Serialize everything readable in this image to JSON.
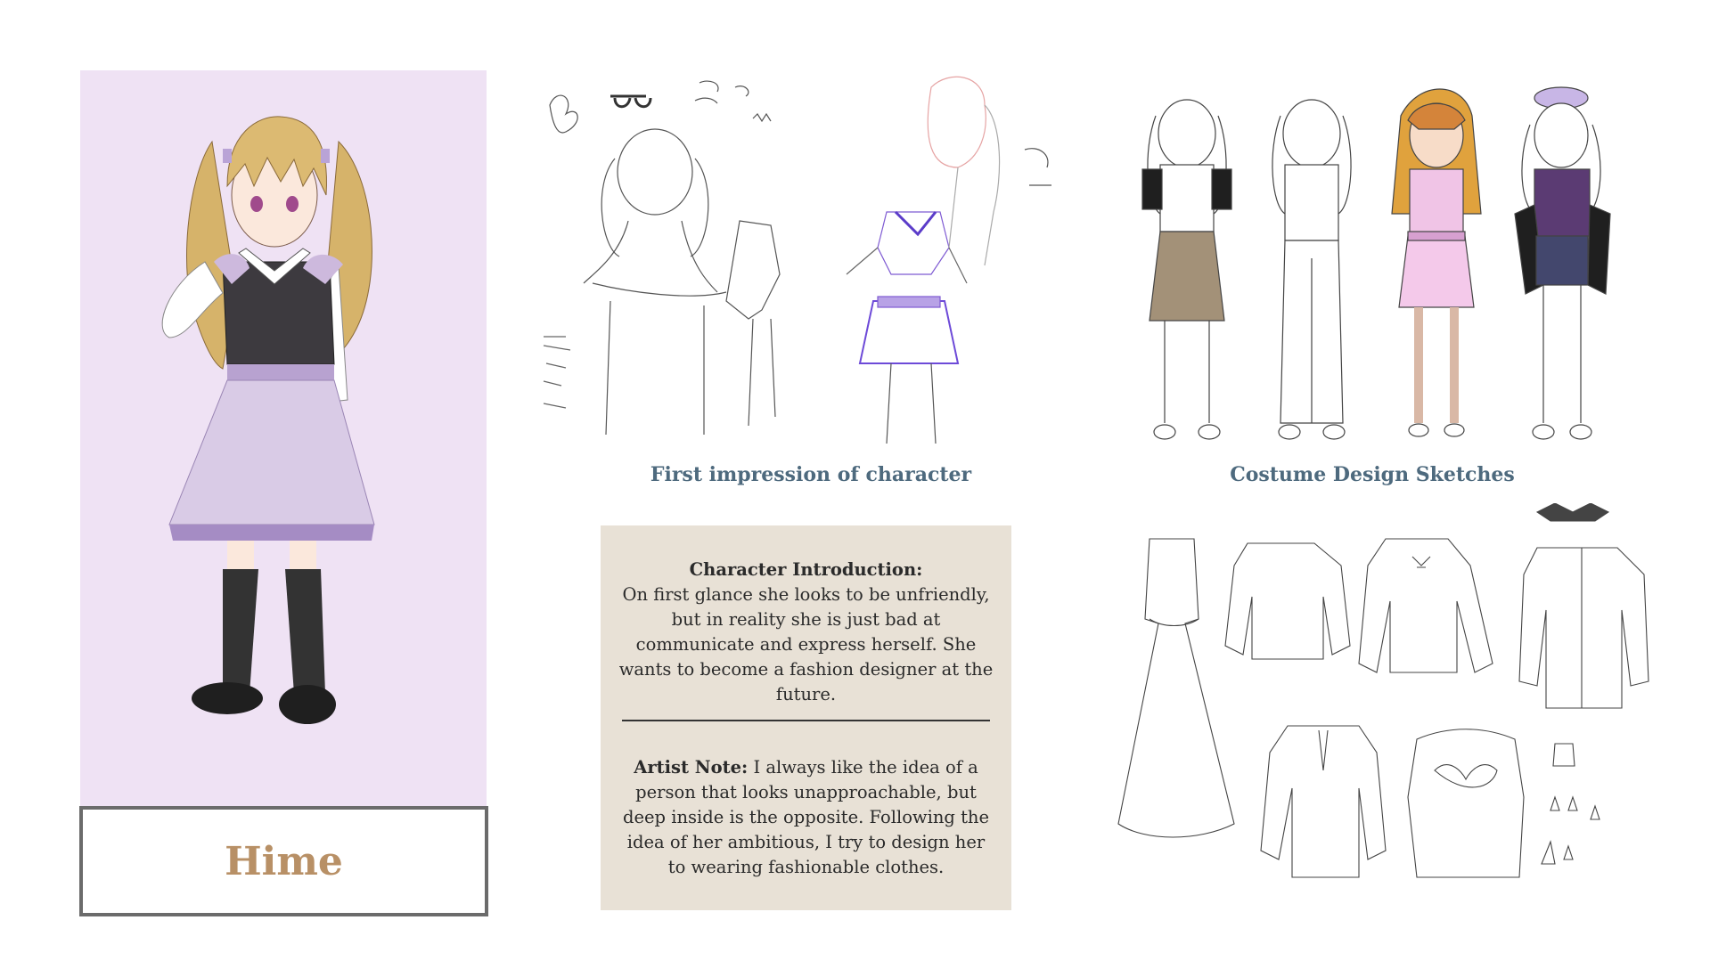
{
  "character": {
    "name": "Hime"
  },
  "captions": {
    "first_impression": "First impression of character",
    "costume_design": "Costume Design Sketches"
  },
  "intro": {
    "heading": "Character Introduction:",
    "body": "On first glance she looks to be unfriendly, but in reality she is just bad at communicate and express herself. She wants to become a fashion designer at the future.",
    "artist_note_label": "Artist Note:",
    "artist_note_text": " I always like the idea of  a person that looks unapproachable, but deep inside is the opposite. Following the idea of her ambitious, I try to design her to wearing fashionable clothes."
  },
  "colors": {
    "panel_background": "#efe2f4",
    "name_color": "#b89066",
    "caption_color": "#4e6a7e",
    "intro_background": "#e8e1d6"
  }
}
